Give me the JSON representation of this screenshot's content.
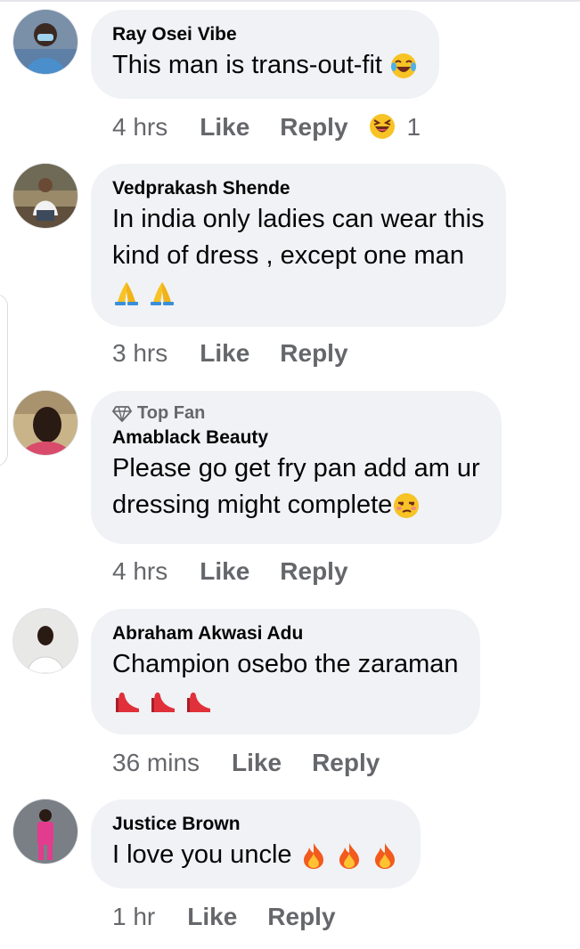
{
  "comments": [
    {
      "author": "Ray Osei Vibe",
      "text_lines": [
        "This man is trans-out-fit"
      ],
      "trailing_emoji": [
        "laughing-crying-emoji"
      ],
      "time": "4 hrs",
      "like": "Like",
      "reply": "Reply",
      "reaction_icon": "laughing-emoji",
      "reaction_count": "1"
    },
    {
      "author": "Vedprakash Shende",
      "text_lines": [
        "In india only ladies can wear this",
        "kind of dress , except one man"
      ],
      "trailing_emoji": [
        "folded-hands-emoji",
        "folded-hands-emoji"
      ],
      "time": "3 hrs",
      "like": "Like",
      "reply": "Reply"
    },
    {
      "badge": "Top Fan",
      "badge_icon": "diamond-icon",
      "author": "Amablack Beauty",
      "text_lines": [
        "Please go get fry pan add am ur",
        "dressing might complete"
      ],
      "trailing_emoji": [
        "unamused-emoji"
      ],
      "time": "4 hrs",
      "like": "Like",
      "reply": "Reply"
    },
    {
      "author": "Abraham Akwasi Adu",
      "text_lines": [
        "Champion osebo the zaraman"
      ],
      "trailing_emoji": [
        "high-heel-emoji",
        "high-heel-emoji",
        "high-heel-emoji"
      ],
      "time": "36 mins",
      "like": "Like",
      "reply": "Reply"
    },
    {
      "author": "Justice Brown",
      "text_lines": [
        "I love you uncle"
      ],
      "trailing_emoji": [
        "fire-emoji",
        "fire-emoji",
        "fire-emoji"
      ],
      "time": "1 hr",
      "like": "Like",
      "reply": "Reply"
    }
  ],
  "colors": {
    "bubble": "#f0f2f5",
    "meta_text": "#65676b",
    "body_text": "#050505"
  }
}
